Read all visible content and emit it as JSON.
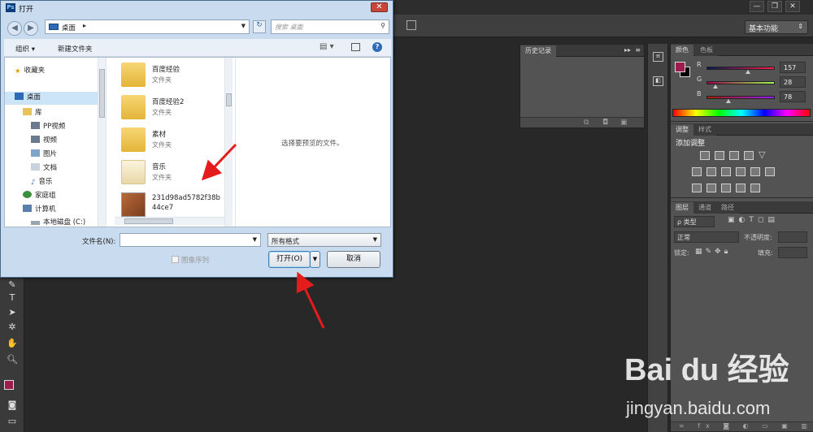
{
  "ps": {
    "workspace_select": "基本功能",
    "history_tab": "历史记录",
    "color_panel": {
      "tabs": [
        "颜色",
        "色板"
      ],
      "channels": [
        {
          "label": "R",
          "value": "157"
        },
        {
          "label": "G",
          "value": "28"
        },
        {
          "label": "B",
          "value": "78"
        }
      ],
      "foreground": "#9d1c4e"
    },
    "adjust_panel": {
      "tabs": [
        "调整",
        "样式"
      ],
      "title": "添加调整"
    },
    "layers_panel": {
      "tabs": [
        "图层",
        "通道",
        "路径"
      ],
      "kind_filter": "ρ 类型",
      "blend_mode": "正常",
      "opacity_label": "不透明度:",
      "lock_label": "锁定:",
      "fill_label": "填充:"
    }
  },
  "dialog": {
    "title": "打开",
    "close": "✕",
    "address": "桌面",
    "address_arrow": "▸",
    "search_placeholder": "搜索 桌面",
    "toolbar": {
      "organize": "组织 ▾",
      "new_folder": "新建文件夹"
    },
    "nav": [
      {
        "label": "收藏夹",
        "icon": "star-icon"
      },
      {
        "label": "桌面",
        "icon": "desktop-icon"
      },
      {
        "label": "库",
        "icon": "library-icon"
      },
      {
        "label": "PP视频",
        "icon": "video-icon"
      },
      {
        "label": "视频",
        "icon": "video-icon"
      },
      {
        "label": "图片",
        "icon": "picture-icon"
      },
      {
        "label": "文档",
        "icon": "document-icon"
      },
      {
        "label": "音乐",
        "icon": "music-icon"
      },
      {
        "label": "家庭组",
        "icon": "homegroup-icon"
      },
      {
        "label": "计算机",
        "icon": "computer-icon"
      },
      {
        "label": "本地磁盘 (C:)",
        "icon": "drive-icon"
      }
    ],
    "files": [
      {
        "name": "百度经验",
        "type": "文件夹"
      },
      {
        "name": "百度经验2",
        "type": "文件夹"
      },
      {
        "name": "素材",
        "type": "文件夹"
      },
      {
        "name": "音乐",
        "type": "文件夹"
      },
      {
        "name": "231d98ad5782f38b",
        "type": "44ce7"
      }
    ],
    "preview_text": "选择要预览的文件。",
    "filename_label": "文件名(N):",
    "filename_value": "",
    "format": "所有格式",
    "image_sequence": "图像序列",
    "open_button": "打开(O)",
    "cancel_button": "取消"
  },
  "watermark": {
    "brand": "Bai du 经验",
    "url": "jingyan.baidu.com"
  }
}
